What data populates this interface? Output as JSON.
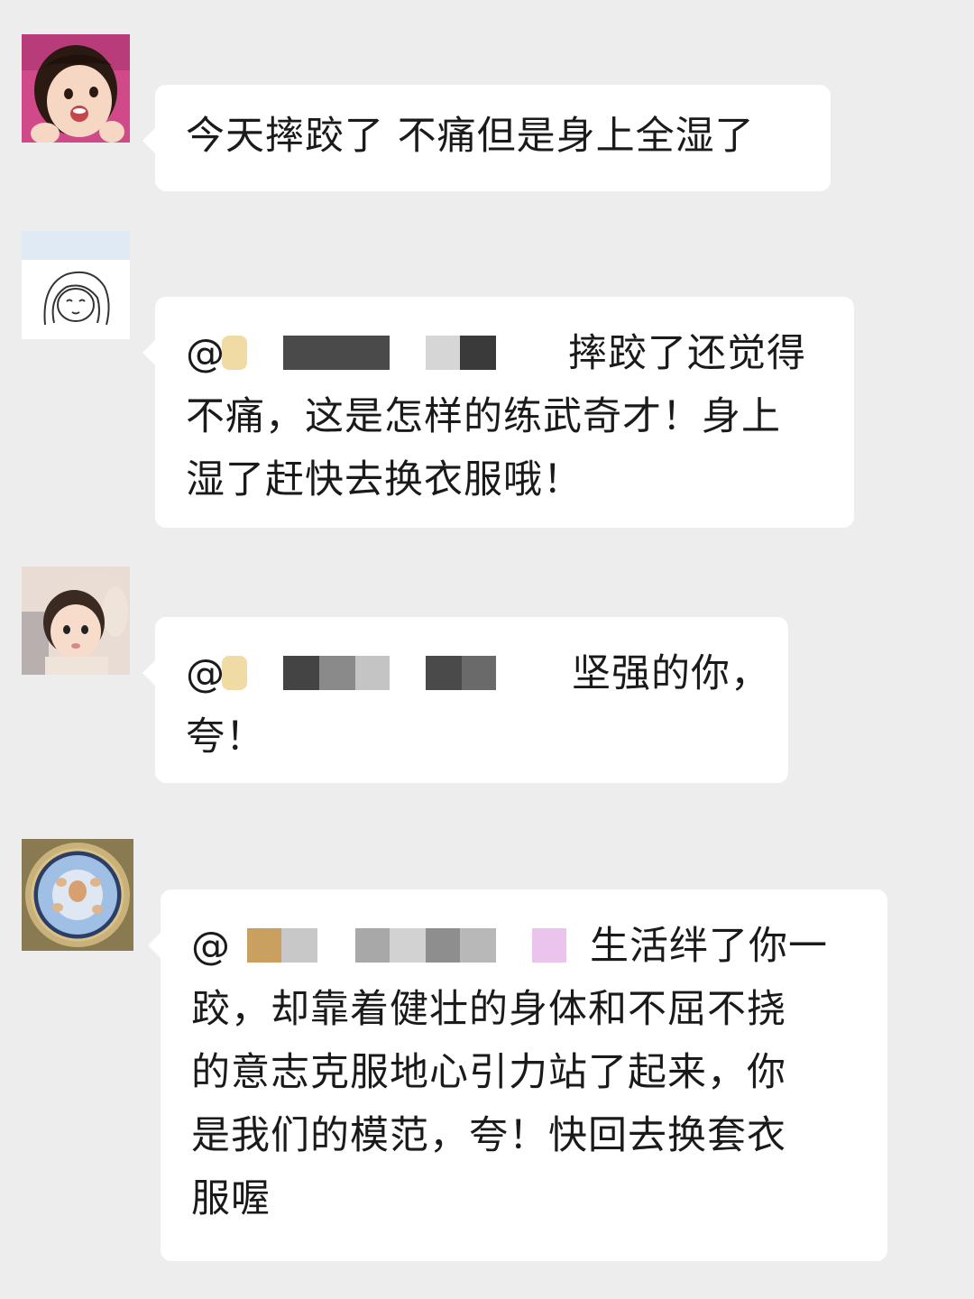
{
  "messages": [
    {
      "sender": "girl-avatar",
      "text_lines": [
        "今天摔跤了 不痛但是身上全湿了"
      ]
    },
    {
      "sender": "sketch-avatar",
      "mention_at": "@",
      "mention_tail": "摔跤了还觉得",
      "text_lines": [
        "不痛，这是怎样的练武奇才！身上",
        "湿了赶快去换衣服哦！"
      ]
    },
    {
      "sender": "baby-avatar",
      "mention_at": "@",
      "mention_tail": "坚强的你，",
      "text_lines": [
        "夸！"
      ]
    },
    {
      "sender": "ceiling-avatar",
      "mention_at": "@",
      "mention_tail": "生活绊了你一",
      "text_lines": [
        "跤，却靠着健壮的身体和不屈不挠",
        "的意志克服地心引力站了起来，你",
        "是我们的模范，夸！快回去换套衣",
        "服喔"
      ]
    }
  ],
  "colors": {
    "background": "#ededed",
    "bubble": "#ffffff",
    "text": "#1a1a1a"
  }
}
